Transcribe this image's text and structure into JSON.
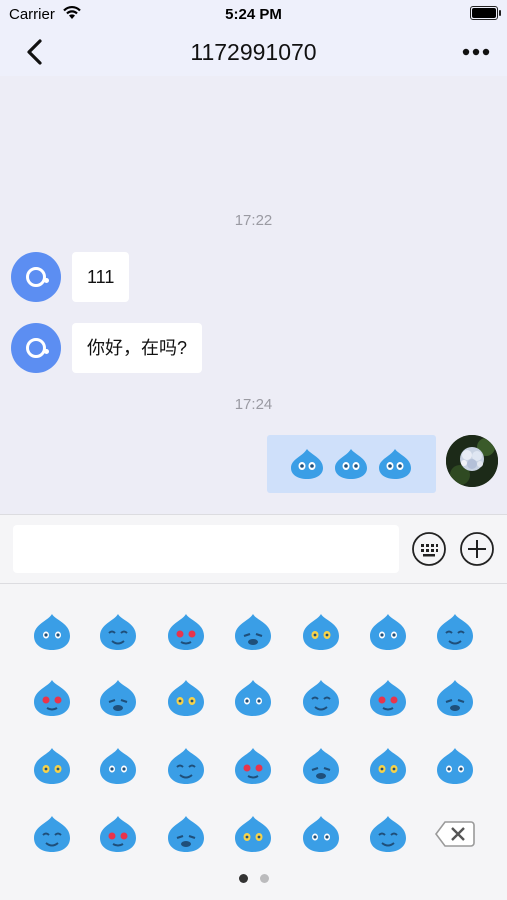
{
  "status_bar": {
    "carrier": "Carrier",
    "time": "5:24 PM",
    "wifi_icon": "wifi-icon",
    "battery_icon": "battery-icon"
  },
  "nav": {
    "title": "1172991070",
    "back_icon": "chevron-left-icon",
    "more_icon": "more-horizontal-icon"
  },
  "messages": {
    "time1": "17:22",
    "msg1": "111",
    "msg2": "你好，在吗?",
    "time2": "17:24",
    "outgoing_sticker_count": 3
  },
  "input": {
    "value": "",
    "placeholder": ""
  },
  "toolbar": {
    "keyboard_icon": "keyboard-icon",
    "plus_icon": "plus-circle-icon"
  },
  "emoji_panel": {
    "rows": 4,
    "columns": 7,
    "delete_icon": "backspace-icon",
    "pages": 2,
    "active_page": 1
  },
  "colors": {
    "accent": "#5c8ef2",
    "bubble_out": "#cfe0fa",
    "emoji_blue": "#3a9ee6"
  }
}
